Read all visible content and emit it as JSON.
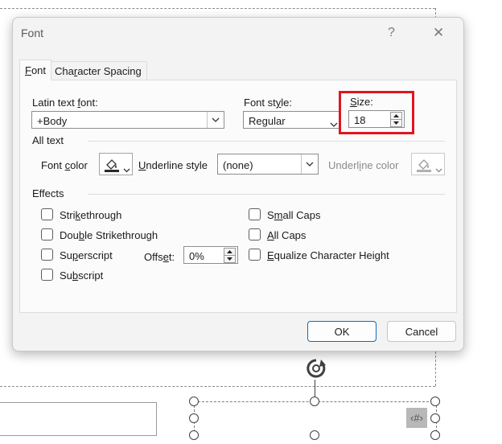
{
  "dialog": {
    "title": "Font",
    "help_label": "?",
    "close_label": "✕"
  },
  "tabs": [
    {
      "label": "Font",
      "underline": "F",
      "rest": "ont",
      "selected": true
    },
    {
      "label": "Character Spacing",
      "pre": "Cha",
      "underline": "r",
      "rest": "acter Spacing",
      "selected": false
    }
  ],
  "latin_font": {
    "label_pre": "Latin text ",
    "label_u": "f",
    "label_post": "ont:",
    "value": "+Body"
  },
  "font_style": {
    "label_pre": "Font st",
    "label_u": "y",
    "label_post": "le:",
    "value": "Regular"
  },
  "size": {
    "label_u": "S",
    "label_post": "ize:",
    "value": "18"
  },
  "all_text": {
    "heading": "All text",
    "font_color_label_pre": "Font ",
    "font_color_label_u": "c",
    "font_color_label_post": "olor",
    "underline_style_label_u": "U",
    "underline_style_label_post": "nderline style",
    "underline_style_value": "(none)",
    "underline_color_label_pre": "Underl",
    "underline_color_label_u": "i",
    "underline_color_label_post": "ne color"
  },
  "effects": {
    "heading": "Effects",
    "strikethrough": {
      "pre": "Stri",
      "u": "k",
      "post": "ethrough"
    },
    "double_strikethrough": {
      "pre": "Dou",
      "u": "b",
      "post": "le Strikethrough"
    },
    "superscript": {
      "pre": "Su",
      "u": "p",
      "post": "erscript"
    },
    "subscript": {
      "pre": "Su",
      "u": "b",
      "post": "script"
    },
    "small_caps": {
      "pre": "S",
      "u": "m",
      "post": "all Caps"
    },
    "all_caps": {
      "pre": "",
      "u": "A",
      "post": "ll Caps"
    },
    "equalize": {
      "pre": "",
      "u": "E",
      "post": "qualize Character Height"
    },
    "offset": {
      "pre": "Offs",
      "u": "e",
      "post": "t:",
      "value": "0%"
    }
  },
  "buttons": {
    "ok": "OK",
    "cancel": "Cancel"
  },
  "slide": {
    "placeholder_symbol": "‹#›"
  },
  "colors": {
    "highlight": "#e0161f",
    "accent": "#0f6cbd"
  }
}
